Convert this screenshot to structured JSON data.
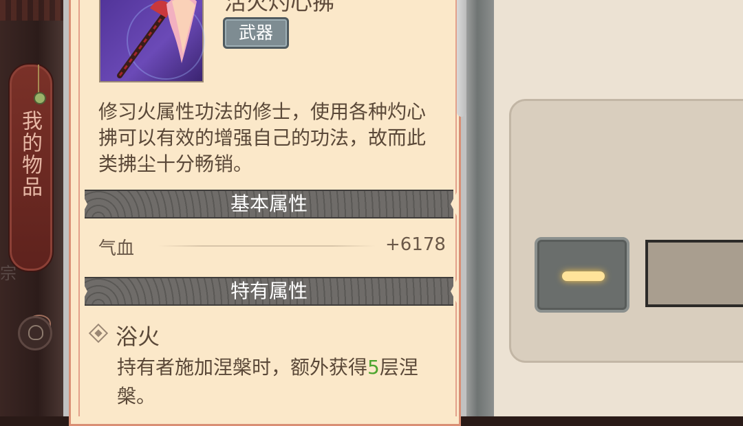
{
  "sidebar": {
    "tab_label": "我的物品",
    "under_text": "宗"
  },
  "item": {
    "title": "活火灼心拂",
    "type_tag": "武器",
    "description": "修习火属性功法的修士，使用各种灼心拂可以有效的增强自己的功法，故而此类拂尘十分畅销。"
  },
  "sections": {
    "basic": "基本属性",
    "special": "特有属性"
  },
  "basic_stats": [
    {
      "name": "气血",
      "value": "+6178"
    }
  ],
  "special_skill": {
    "name": "浴火",
    "desc_before": "持有者施加涅槃时，额外获得",
    "stacks": "5",
    "desc_after": "层涅槃。"
  },
  "colors": {
    "highlight_green": "#4da52e",
    "band_bg": "#5e5c59",
    "paper": "#fbe8c9"
  },
  "icons": {
    "slot_button": "minus-icon",
    "bag": "bag-icon",
    "skill_bullet": "diamond-icon"
  }
}
